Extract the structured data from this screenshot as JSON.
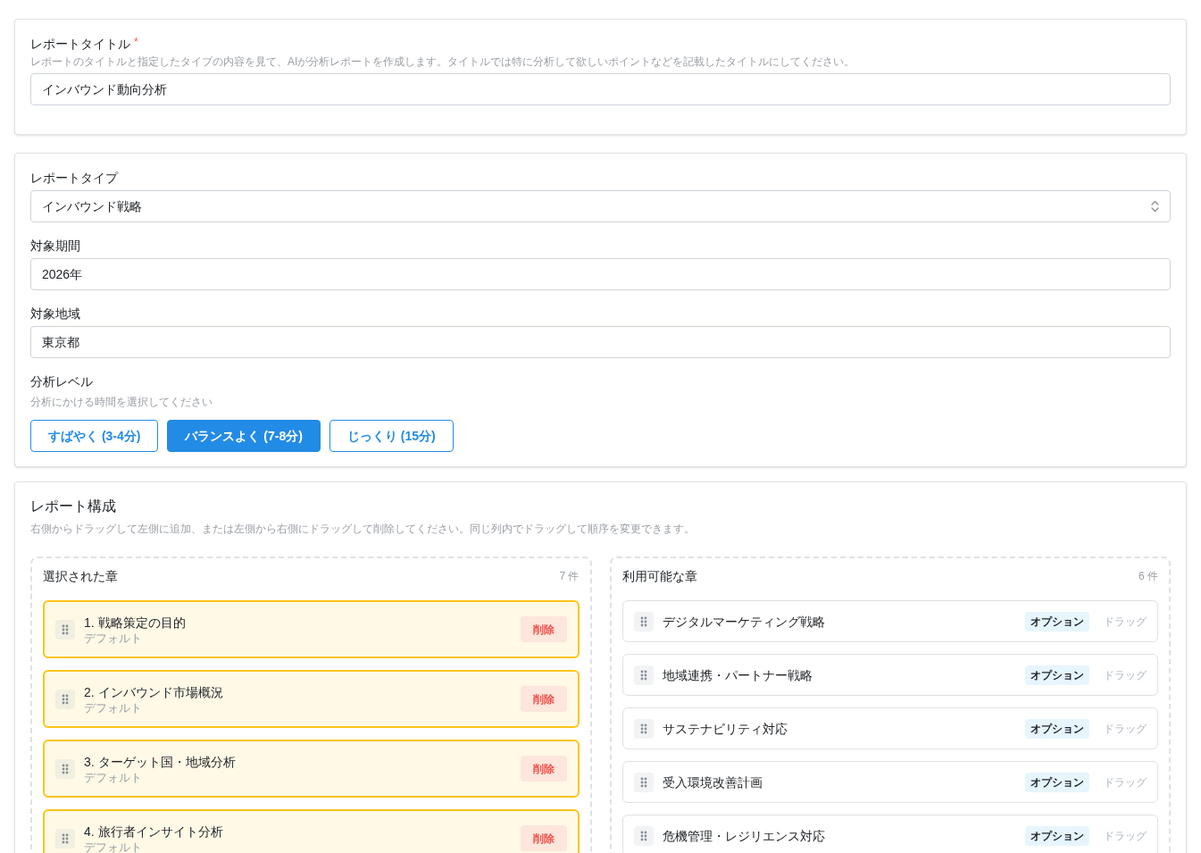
{
  "report_title": {
    "label": "レポートタイトル",
    "required_mark": "*",
    "help": "レポートのタイトルと指定したタイプの内容を見て、AIが分析レポートを作成します。タイトルでは特に分析して欲しいポイントなどを記載したタイトルにしてください。",
    "value": "インバウンド動向分析"
  },
  "settings": {
    "fields": [
      {
        "kind": "select",
        "label": "レポートタイプ",
        "value": "インバウンド戦略"
      },
      {
        "kind": "text",
        "label": "対象期間",
        "value": "2026年"
      },
      {
        "kind": "text",
        "label": "対象地域",
        "value": "東京都"
      }
    ],
    "analysis_level": {
      "label": "分析レベル",
      "help": "分析にかける時間を選択してください",
      "options": [
        {
          "label": "すばやく (3-4分)",
          "selected": false
        },
        {
          "label": "バランスよく (7-8分)",
          "selected": true
        },
        {
          "label": "じっくり (15分)",
          "selected": false
        }
      ]
    }
  },
  "composition": {
    "title": "レポート構成",
    "help": "右側からドラッグして左側に追加、または左側から右側にドラッグして削除してください。同じ列内でドラッグして順序を変更できます。",
    "selected_panel": {
      "title": "選択された章",
      "count": "7 件",
      "items": [
        {
          "title": "1. 戦略策定の目的",
          "subtitle": "デフォルト",
          "action": "削除"
        },
        {
          "title": "2. インバウンド市場概況",
          "subtitle": "デフォルト",
          "action": "削除"
        },
        {
          "title": "3. ターゲット国・地域分析",
          "subtitle": "デフォルト",
          "action": "削除"
        },
        {
          "title": "4. 旅行者インサイト分析",
          "subtitle": "デフォルト",
          "action": "削除"
        }
      ]
    },
    "available_panel": {
      "title": "利用可能な章",
      "count": "6 件",
      "items": [
        {
          "title": "デジタルマーケティング戦略",
          "badge": "オプション",
          "hint": "ドラッグ"
        },
        {
          "title": "地域連携・パートナー戦略",
          "badge": "オプション",
          "hint": "ドラッグ"
        },
        {
          "title": "サステナビリティ対応",
          "badge": "オプション",
          "hint": "ドラッグ"
        },
        {
          "title": "受入環境改善計画",
          "badge": "オプション",
          "hint": "ドラッグ"
        },
        {
          "title": "危機管理・レジリエンス対応",
          "badge": "オプション",
          "hint": "ドラッグ"
        }
      ]
    }
  }
}
